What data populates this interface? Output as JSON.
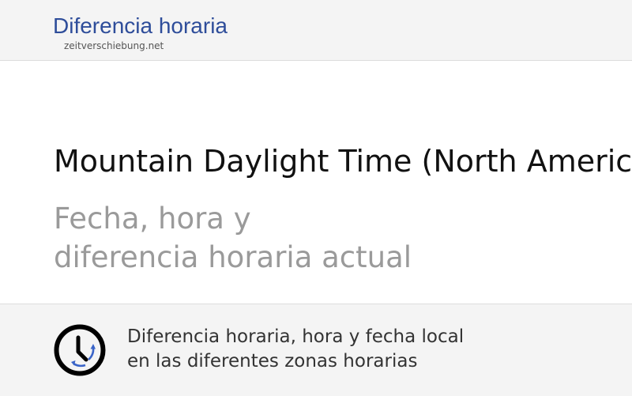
{
  "header": {
    "site_title": "Diferencia horaria",
    "site_domain": "zeitverschiebung.net"
  },
  "hero": {
    "title": "Mountain Daylight Time (North America)",
    "subtitle_line1": "Fecha, hora y",
    "subtitle_line2": "diferencia horaria actual"
  },
  "footer": {
    "icon": "clock-icon",
    "line1": "Diferencia horaria, hora y fecha local",
    "line2": "en las diferentes zonas horarias"
  },
  "colors": {
    "brand": "#2e4d9a",
    "header_bg": "#f4f4f4",
    "subtitle": "#9a9a9a",
    "clock_arrows": "#3a64c8"
  }
}
